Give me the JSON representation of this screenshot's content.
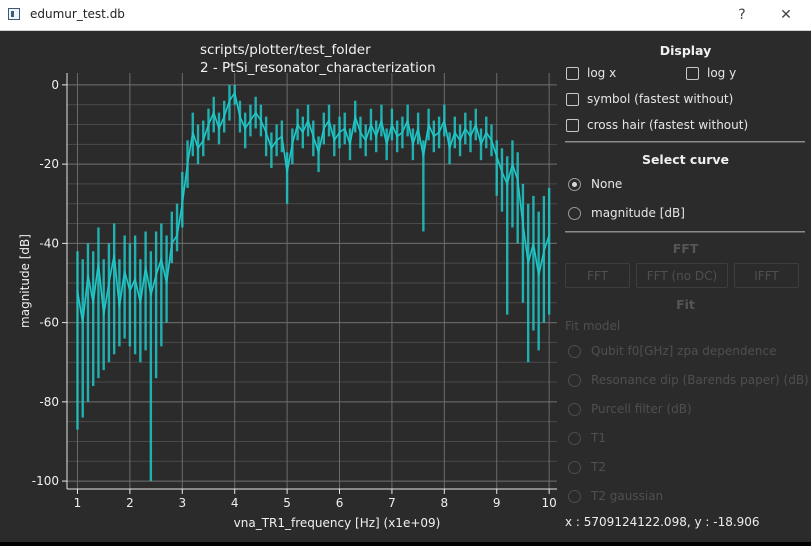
{
  "window": {
    "title": "edumur_test.db",
    "help_label": "?",
    "close_label": "✕",
    "app_icon": "database-window-icon"
  },
  "plot": {
    "title_line1": "scripts/plotter/test_folder",
    "title_line2": "2 - PtSi_resonator_characterization",
    "trace_color": "#1fc8c8",
    "background_color": "#2b2b2b"
  },
  "chart_data": {
    "type": "line",
    "title": "scripts/plotter/test_folder\n2 - PtSi_resonator_characterization",
    "xlabel": "vna_TR1_frequency [Hz] (x1e+09)",
    "ylabel": "magnitude [dB]",
    "xlim": [
      0.8,
      10.15
    ],
    "ylim": [
      -102,
      3
    ],
    "x_ticks": [
      1,
      2,
      3,
      4,
      5,
      6,
      7,
      8,
      9,
      10
    ],
    "y_ticks": [
      0,
      -20,
      -40,
      -60,
      -80,
      -100
    ],
    "grid": true,
    "legend": "none",
    "series": [
      {
        "x": [
          1.0,
          1.1,
          1.2,
          1.3,
          1.4,
          1.5,
          1.6,
          1.7,
          1.8,
          1.9,
          2.0,
          2.1,
          2.2,
          2.3,
          2.4,
          2.5,
          2.6,
          2.7,
          2.8,
          2.9,
          3.0,
          3.1,
          3.2,
          3.3,
          3.4,
          3.5,
          3.6,
          3.7,
          3.8,
          3.9,
          4.0,
          4.1,
          4.2,
          4.3,
          4.4,
          4.5,
          4.6,
          4.7,
          4.8,
          4.9,
          5.0,
          5.1,
          5.2,
          5.3,
          5.4,
          5.5,
          5.6,
          5.7,
          5.8,
          5.9,
          6.0,
          6.1,
          6.2,
          6.3,
          6.4,
          6.5,
          6.6,
          6.7,
          6.8,
          6.9,
          7.0,
          7.1,
          7.2,
          7.3,
          7.4,
          7.5,
          7.6,
          7.7,
          7.8,
          7.9,
          8.0,
          8.1,
          8.2,
          8.3,
          8.4,
          8.5,
          8.6,
          8.7,
          8.8,
          8.9,
          9.0,
          9.1,
          9.2,
          9.3,
          9.4,
          9.5,
          9.6,
          9.7,
          9.8,
          9.9,
          10.0
        ],
        "y": [
          -52,
          -60,
          -48,
          -55,
          -45,
          -58,
          -50,
          -43,
          -56,
          -47,
          -52,
          -49,
          -55,
          -46,
          -53,
          -48,
          -44,
          -50,
          -40,
          -38,
          -30,
          -20,
          -12,
          -16,
          -14,
          -10,
          -7,
          -11,
          -8,
          -4,
          -2,
          -8,
          -11,
          -9,
          -7,
          -9,
          -12,
          -16,
          -14,
          -13,
          -22,
          -15,
          -10,
          -12,
          -9,
          -13,
          -17,
          -11,
          -9,
          -14,
          -12,
          -11,
          -15,
          -8,
          -12,
          -14,
          -10,
          -13,
          -9,
          -15,
          -10,
          -13,
          -12,
          -9,
          -15,
          -11,
          -18,
          -10,
          -13,
          -12,
          -9,
          -16,
          -12,
          -14,
          -11,
          -13,
          -10,
          -15,
          -12,
          -14,
          -18,
          -22,
          -25,
          -20,
          -24,
          -35,
          -45,
          -40,
          -48,
          -42,
          -38
        ],
        "y_min": [
          -87,
          -84,
          -80,
          -76,
          -74,
          -72,
          -70,
          -68,
          -66,
          -64,
          -66,
          -68,
          -70,
          -67,
          -100,
          -74,
          -66,
          -60,
          -45,
          -42,
          -36,
          -26,
          -18,
          -20,
          -18,
          -14,
          -12,
          -15,
          -12,
          -9,
          -5,
          -12,
          -16,
          -13,
          -11,
          -13,
          -18,
          -21,
          -18,
          -17,
          -30,
          -20,
          -14,
          -16,
          -13,
          -18,
          -22,
          -15,
          -13,
          -18,
          -16,
          -15,
          -19,
          -12,
          -16,
          -18,
          -14,
          -17,
          -13,
          -19,
          -14,
          -17,
          -16,
          -13,
          -19,
          -15,
          -37,
          -14,
          -17,
          -16,
          -13,
          -20,
          -16,
          -18,
          -15,
          -17,
          -14,
          -19,
          -16,
          -18,
          -28,
          -32,
          -58,
          -36,
          -40,
          -55,
          -70,
          -62,
          -67,
          -60,
          -58
        ],
        "y_max": [
          -42,
          -44,
          -40,
          -42,
          -36,
          -44,
          -40,
          -35,
          -44,
          -38,
          -40,
          -38,
          -44,
          -37,
          -42,
          -37,
          -35,
          -38,
          -32,
          -30,
          -22,
          -14,
          -7,
          -10,
          -9,
          -6,
          -3,
          -7,
          -4,
          0,
          0,
          -4,
          -7,
          -5,
          -3,
          -5,
          -8,
          -12,
          -10,
          -9,
          -17,
          -11,
          -6,
          -8,
          -5,
          -9,
          -13,
          -7,
          -5,
          -10,
          -8,
          -7,
          -11,
          -4,
          -8,
          -10,
          -6,
          -9,
          -5,
          -11,
          -6,
          -9,
          -8,
          -5,
          -11,
          -7,
          -14,
          -6,
          -9,
          -8,
          -5,
          -12,
          -8,
          -10,
          -7,
          -9,
          -6,
          -11,
          -8,
          -10,
          -14,
          -16,
          -18,
          -14,
          -17,
          -25,
          -30,
          -28,
          -32,
          -28,
          -26
        ]
      }
    ]
  },
  "panel": {
    "display_title": "Display",
    "log_x_label": "log x",
    "log_y_label": "log y",
    "symbol_label": "symbol (fastest without)",
    "crosshair_label": "cross hair (fastest without)",
    "select_curve_title": "Select curve",
    "curve_none_label": "None",
    "curve_magnitude_label": "magnitude [dB]",
    "fft_title": "FFT",
    "fft_button": "FFT",
    "fft_nodc_button": "FFT (no DC)",
    "ifft_button": "IFFT",
    "fit_title": "Fit",
    "fit_model_label": "Fit model",
    "fit_models": [
      "Qubit f0[GHz] zpa dependence",
      "Resonance dip (Barends paper) (dB)",
      "Purcell filter (dB)",
      "T1",
      "T2",
      "T2 gaussian"
    ]
  },
  "status": {
    "coordinates": "x : 5709124122.098, y : -18.906"
  }
}
